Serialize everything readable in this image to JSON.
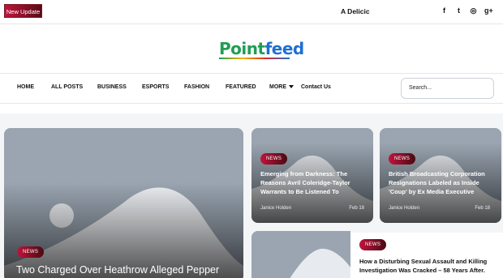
{
  "topbar": {
    "update_label": "New Update",
    "ticker_text": "A Delicic",
    "social": [
      {
        "icon": "facebook-icon",
        "glyph": "f"
      },
      {
        "icon": "twitter-icon",
        "glyph": "t"
      },
      {
        "icon": "instagram-icon",
        "glyph": "◎"
      },
      {
        "icon": "google-plus-icon",
        "glyph": "g+"
      }
    ]
  },
  "logo": {
    "part1": "Point",
    "part2": "feed"
  },
  "nav": {
    "items": [
      "HOME",
      "ALL POSTS",
      "BUSINESS",
      "ESPORTS",
      "FASHION",
      "FEATURED",
      "MORE",
      "Contact Us"
    ],
    "search_placeholder": "Search..."
  },
  "featured": {
    "badge": "NEWS",
    "title": "Two Charged Over Heathrow Alleged Pepper"
  },
  "cards": [
    {
      "badge": "NEWS",
      "title": "Emerging from Darkness: The Reasons Avril Coleridge-Taylor Warrants to Be Listened To",
      "author": "Janice Holden",
      "date": "Feb 18"
    },
    {
      "badge": "NEWS",
      "title": "British Broadcasting Corporation Resignations Labeled as Inside 'Coup' by Ex Media Executive",
      "author": "Janice Holden",
      "date": "Feb 18"
    }
  ],
  "side_story": {
    "badge": "NEWS",
    "title": "How a Disturbing Sexual Assault and Killing Investigation Was Cracked – 58 Years After."
  },
  "colors": {
    "accent": "#c0143c",
    "placeholder_bg": "#9aa5b1"
  }
}
